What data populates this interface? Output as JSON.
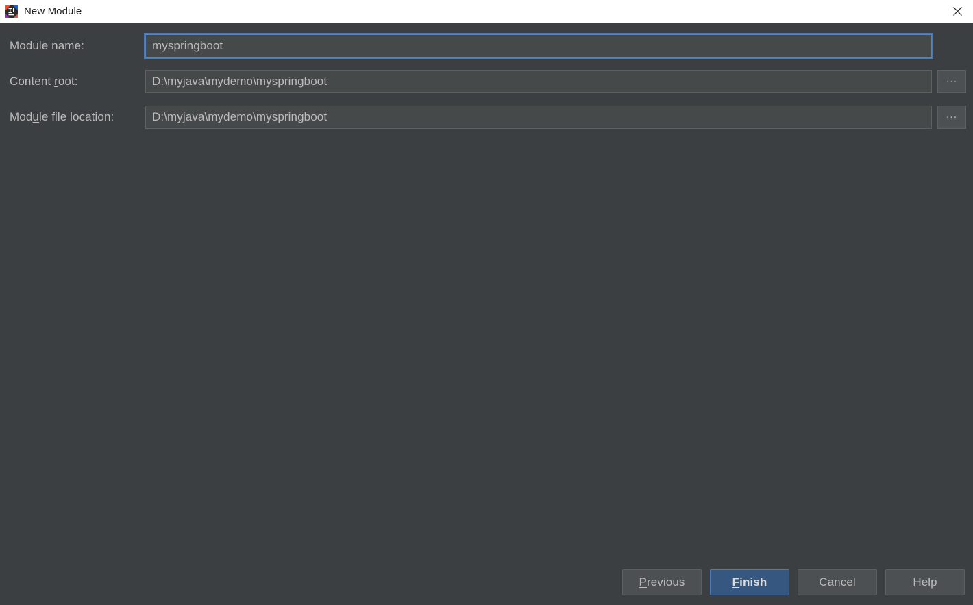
{
  "window": {
    "title": "New Module",
    "icon": "intellij-idea-logo-icon",
    "close_icon": "close-icon"
  },
  "colors": {
    "titlebar_background": "#ffffff",
    "titlebar_text": "#1c1c1c",
    "dialog_background": "#3c3f41",
    "field_background": "#45494a",
    "field_border": "#5e6060",
    "focus_border": "#4a7ab5",
    "label_text": "#bbbbbb",
    "button_background": "#4c5052",
    "default_button_background": "#365880",
    "default_button_border": "#4a7ab5"
  },
  "form": {
    "fields": [
      {
        "label_before": "Module na",
        "label_mnemonic": "m",
        "label_after": "e:",
        "value": "myspringboot",
        "placeholder": "",
        "focused": true,
        "has_browse": false
      },
      {
        "label_before": "Content ",
        "label_mnemonic": "r",
        "label_after": "oot:",
        "value": "D:\\myjava\\mydemo\\myspringboot",
        "placeholder": "",
        "focused": false,
        "has_browse": true,
        "browse_label": "..."
      },
      {
        "label_before": "Mod",
        "label_mnemonic": "u",
        "label_after": "le file location:",
        "value": "D:\\myjava\\mydemo\\myspringboot",
        "placeholder": "",
        "focused": false,
        "has_browse": true,
        "browse_label": "..."
      }
    ]
  },
  "footer": {
    "buttons": [
      {
        "name": "previous",
        "before": "",
        "mnemonic": "P",
        "after": "revious",
        "default": false
      },
      {
        "name": "finish",
        "before": "",
        "mnemonic": "F",
        "after": "inish",
        "default": true
      },
      {
        "name": "cancel",
        "before": "Cancel",
        "mnemonic": "",
        "after": "",
        "default": false
      },
      {
        "name": "help",
        "before": "Help",
        "mnemonic": "",
        "after": "",
        "default": false
      }
    ]
  }
}
